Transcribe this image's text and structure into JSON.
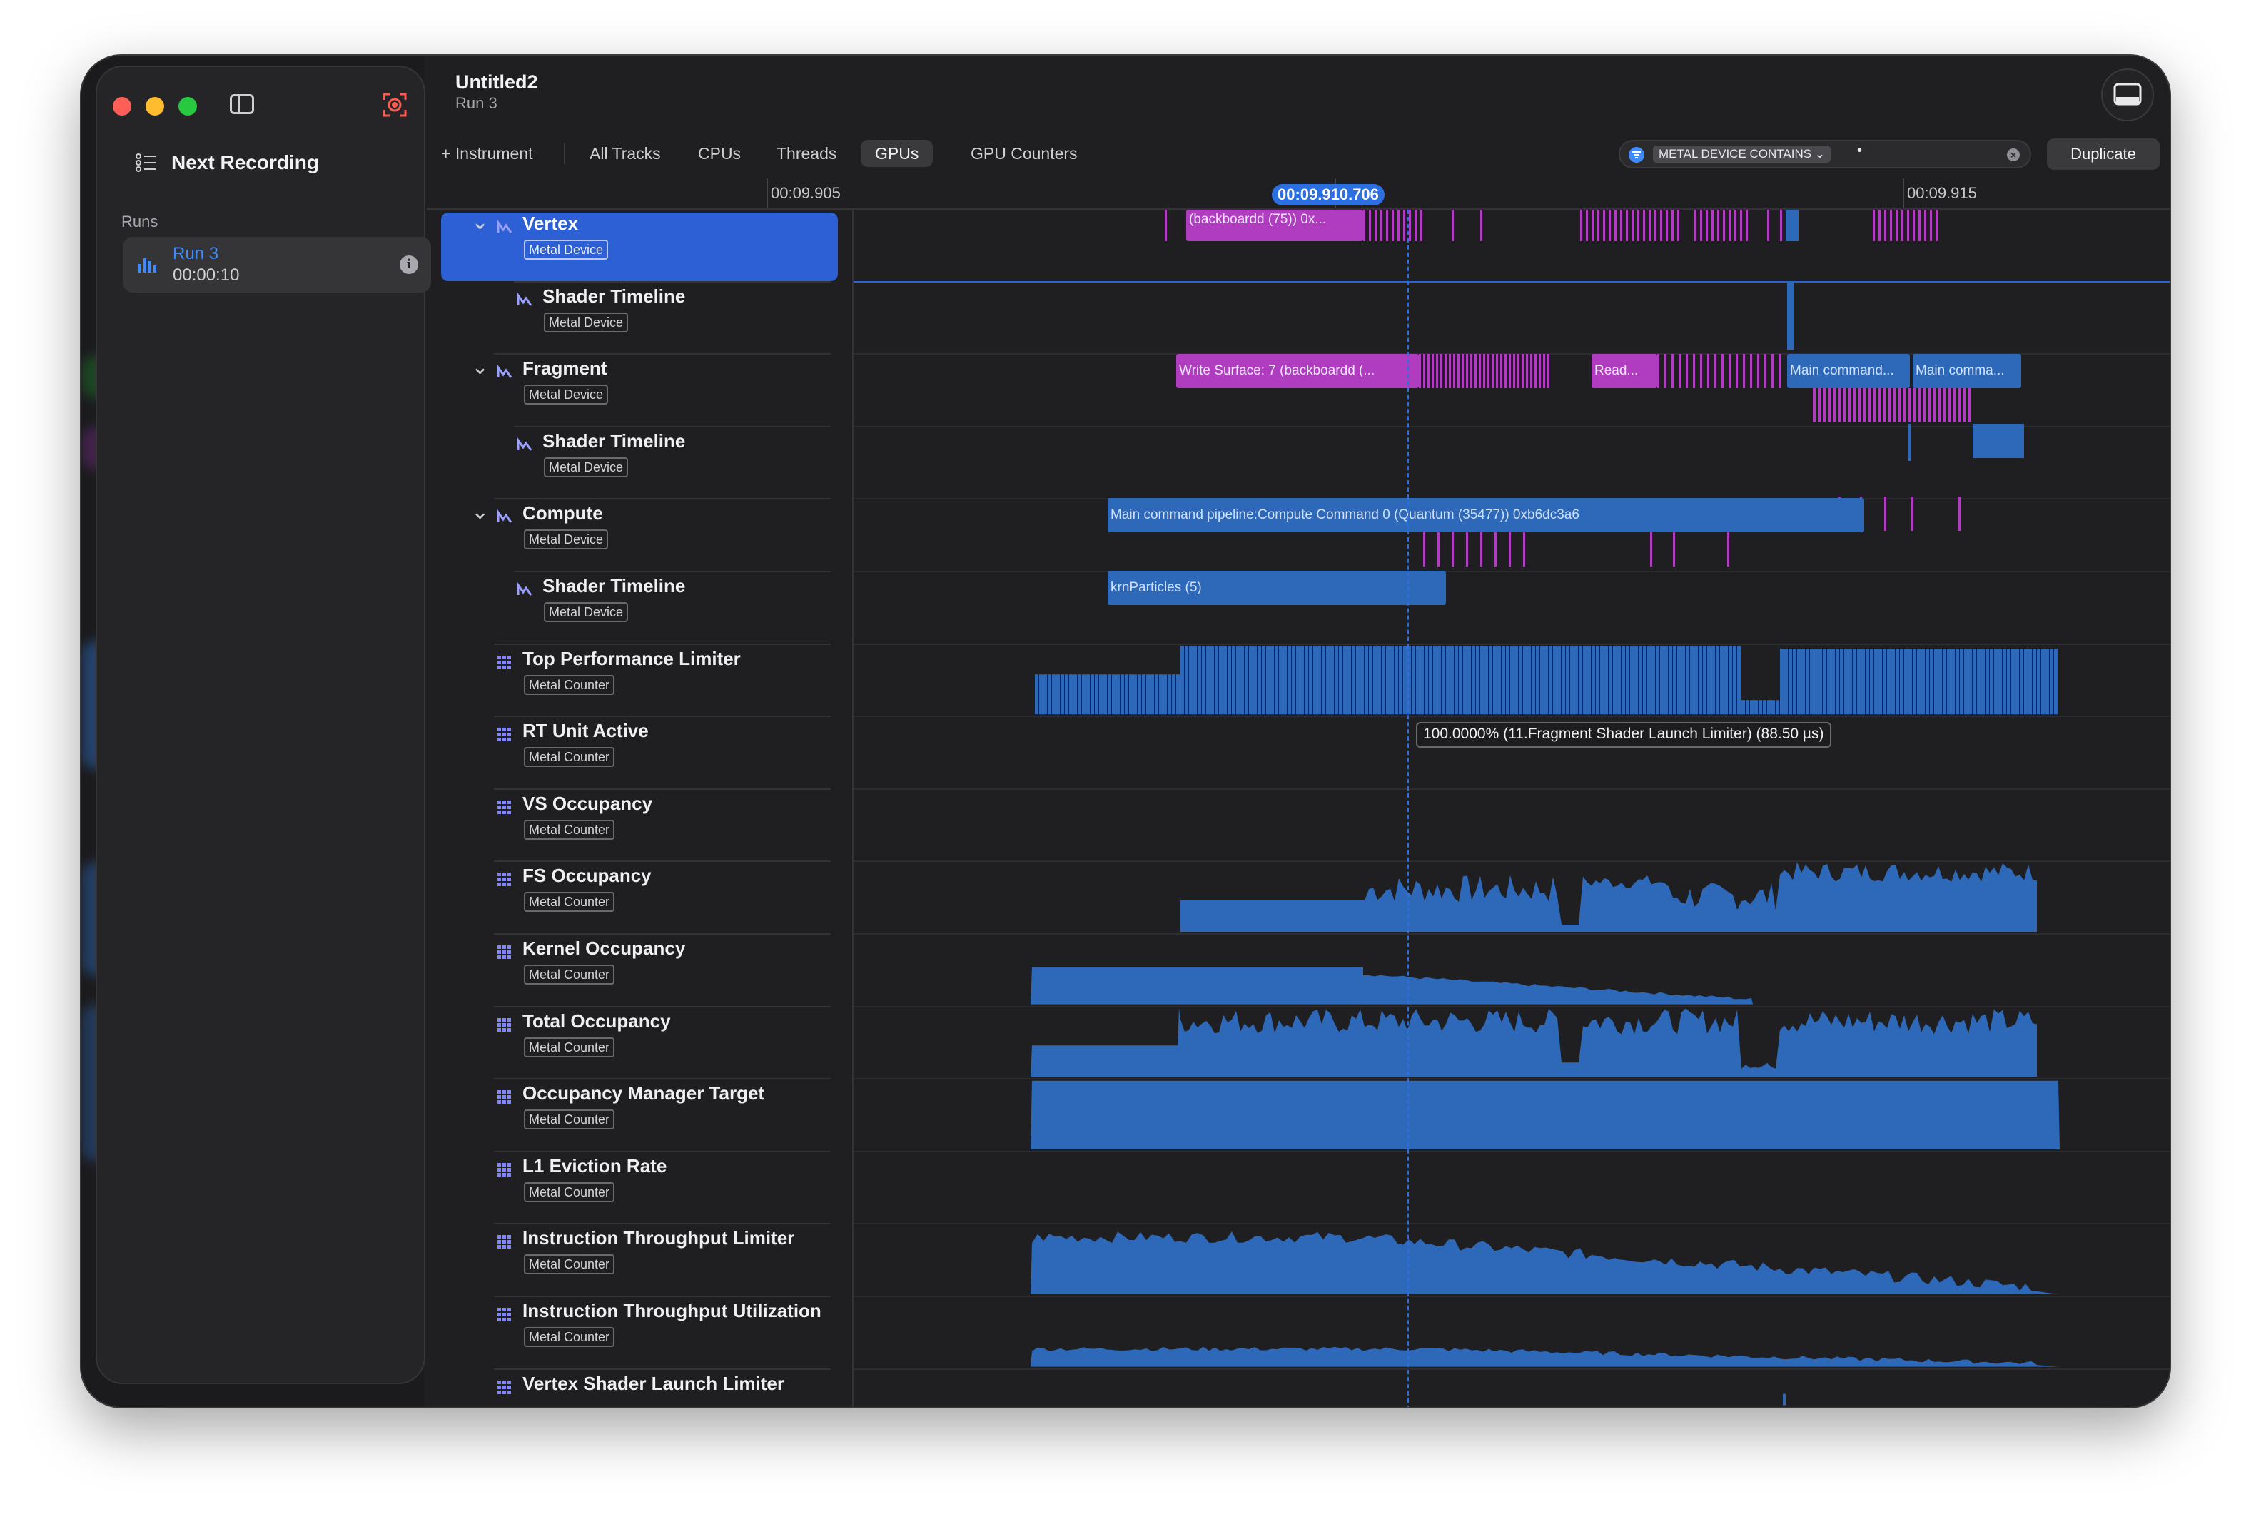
{
  "window": {
    "title": "Untitled2",
    "subtitle": "Run 3"
  },
  "sidebar": {
    "next_recording": "Next Recording",
    "runs_label": "Runs",
    "run": {
      "name": "Run 3",
      "time": "00:00:10"
    }
  },
  "toolbar": {
    "instrument": "+ Instrument",
    "tabs": [
      "All Tracks",
      "CPUs",
      "Threads",
      "GPUs",
      "GPU Counters"
    ],
    "active_tab": "GPUs",
    "filter_chip": "METAL DEVICE CONTAINS ⌄",
    "filter_value": "•",
    "duplicate": "Duplicate"
  },
  "ruler": {
    "labels": [
      "00:09.905",
      "0",
      "00:09.915"
    ],
    "cursor": "00:09.910.706"
  },
  "tracks": [
    {
      "name": "Vertex",
      "tag": "Metal Device"
    },
    {
      "name": "Shader Timeline",
      "tag": "Metal Device"
    },
    {
      "name": "Fragment",
      "tag": "Metal Device"
    },
    {
      "name": "Shader Timeline",
      "tag": "Metal Device"
    },
    {
      "name": "Compute",
      "tag": "Metal Device"
    },
    {
      "name": "Shader Timeline",
      "tag": "Metal Device"
    },
    {
      "name": "Top Performance Limiter",
      "tag": "Metal Counter"
    },
    {
      "name": "RT Unit Active",
      "tag": "Metal Counter"
    },
    {
      "name": "VS Occupancy",
      "tag": "Metal Counter"
    },
    {
      "name": "FS Occupancy",
      "tag": "Metal Counter"
    },
    {
      "name": "Kernel Occupancy",
      "tag": "Metal Counter"
    },
    {
      "name": "Total Occupancy",
      "tag": "Metal Counter"
    },
    {
      "name": "Occupancy Manager Target",
      "tag": "Metal Counter"
    },
    {
      "name": "L1 Eviction Rate",
      "tag": "Metal Counter"
    },
    {
      "name": "Instruction Throughput Limiter",
      "tag": "Metal Counter"
    },
    {
      "name": "Instruction Throughput Utilization",
      "tag": "Metal Counter"
    },
    {
      "name": "Vertex Shader Launch Limiter",
      "tag": ""
    }
  ],
  "blocks": {
    "vertex": "(backboardd (75)) 0x...",
    "fragment_1": "Write Surface: 7   (backboardd (...",
    "fragment_2": "Read...",
    "fragment_3": "Main command...",
    "fragment_4": "Main comma...",
    "compute": "Main command pipeline:Compute Command 0   (Quantum (35477)) 0xb6dc3a6",
    "compute_shader": "krnParticles (5)"
  },
  "tooltip": "100.0000% (11.Fragment Shader Launch Limiter) (88.50 µs)",
  "colors": {
    "accent": "#2c6fe0",
    "bar_blue": "#2e68b8",
    "bar_magenta": "#b03cc0",
    "selection": "#2c60d4"
  }
}
